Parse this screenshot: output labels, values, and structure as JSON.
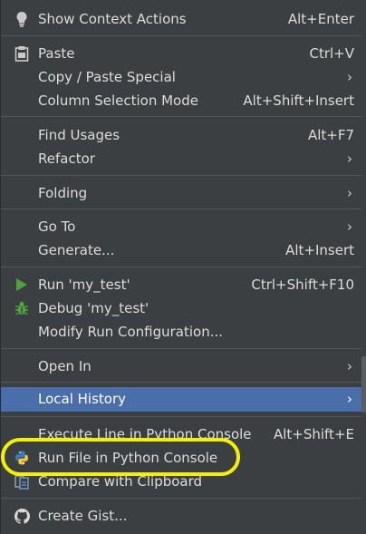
{
  "menu": {
    "colors": {
      "background": "#3c3f41",
      "selected": "#4a6ea9",
      "separator": "#515658",
      "highlight": "#f5f000"
    },
    "items": [
      {
        "label": "Show Context Actions",
        "shortcut": "Alt+Enter",
        "icon": "lightbulb-icon"
      },
      {
        "label": "Paste",
        "shortcut": "Ctrl+V",
        "icon": "clipboard-icon"
      },
      {
        "label": "Copy / Paste Special",
        "submenu": true
      },
      {
        "label": "Column Selection Mode",
        "shortcut": "Alt+Shift+Insert"
      },
      {
        "label": "Find Usages",
        "shortcut": "Alt+F7"
      },
      {
        "label": "Refactor",
        "submenu": true
      },
      {
        "label": "Folding",
        "submenu": true
      },
      {
        "label": "Go To",
        "submenu": true
      },
      {
        "label": "Generate...",
        "shortcut": "Alt+Insert"
      },
      {
        "label": "Run 'my_test'",
        "shortcut": "Ctrl+Shift+F10",
        "icon": "play-icon"
      },
      {
        "label": "Debug 'my_test'",
        "icon": "bug-icon"
      },
      {
        "label": "Modify Run Configuration..."
      },
      {
        "label": "Open In",
        "submenu": true
      },
      {
        "label": "Local History",
        "submenu": true,
        "selected": true
      },
      {
        "label": "Execute Line in Python Console",
        "shortcut": "Alt+Shift+E"
      },
      {
        "label": "Run File in Python Console",
        "icon": "python-icon"
      },
      {
        "label": "Compare with Clipboard",
        "icon": "compare-icon"
      },
      {
        "label": "Create Gist...",
        "icon": "github-icon"
      }
    ],
    "chevron": "›"
  }
}
